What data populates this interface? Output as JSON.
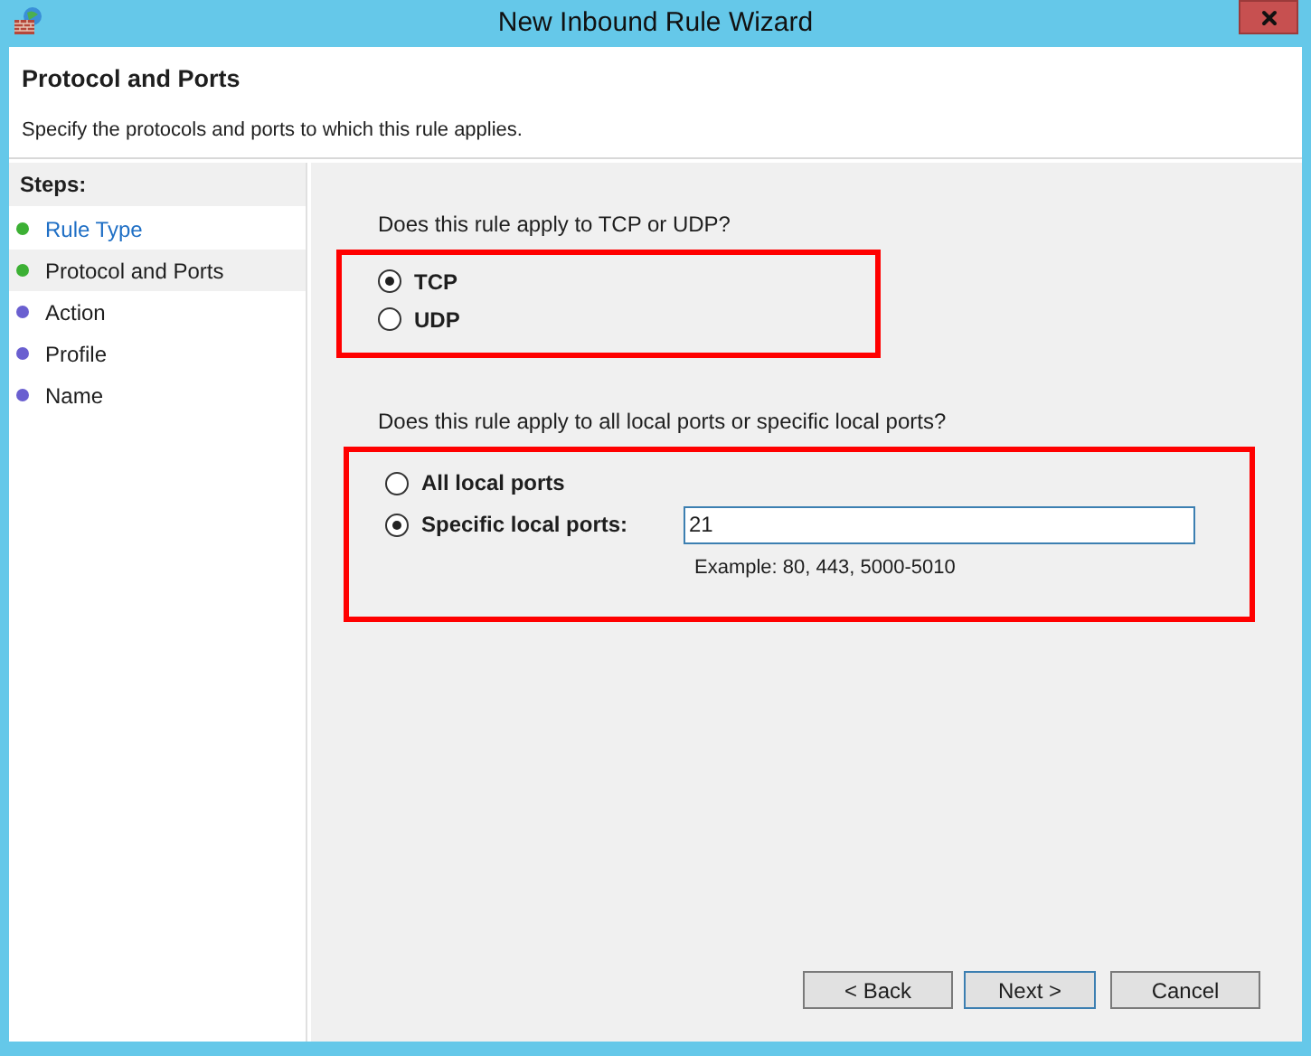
{
  "window": {
    "title": "New Inbound Rule Wizard"
  },
  "header": {
    "title": "Protocol and Ports",
    "subtitle": "Specify the protocols and ports to which this rule applies."
  },
  "steps": {
    "label": "Steps:",
    "items": [
      {
        "label": "Rule Type",
        "kind": "link",
        "selected": false,
        "color": "#3cb034"
      },
      {
        "label": "Protocol and Ports",
        "kind": "text",
        "selected": true,
        "color": "#3cb034"
      },
      {
        "label": "Action",
        "kind": "text",
        "selected": false,
        "color": "#6a5fd0"
      },
      {
        "label": "Profile",
        "kind": "text",
        "selected": false,
        "color": "#6a5fd0"
      },
      {
        "label": "Name",
        "kind": "text",
        "selected": false,
        "color": "#6a5fd0"
      }
    ]
  },
  "protocol": {
    "question": "Does this rule apply to TCP or UDP?",
    "options": [
      {
        "label": "TCP",
        "selected": true
      },
      {
        "label": "UDP",
        "selected": false
      }
    ]
  },
  "ports": {
    "question": "Does this rule apply to all local ports or specific local ports?",
    "options": [
      {
        "label": "All local ports",
        "selected": false
      },
      {
        "label": "Specific local ports:",
        "selected": true
      }
    ],
    "value": "21",
    "example": "Example: 80, 443, 5000-5010"
  },
  "buttons": [
    {
      "label": "< Back",
      "focused": false
    },
    {
      "label": "Next >",
      "focused": true
    },
    {
      "label": "Cancel",
      "focused": false
    }
  ]
}
